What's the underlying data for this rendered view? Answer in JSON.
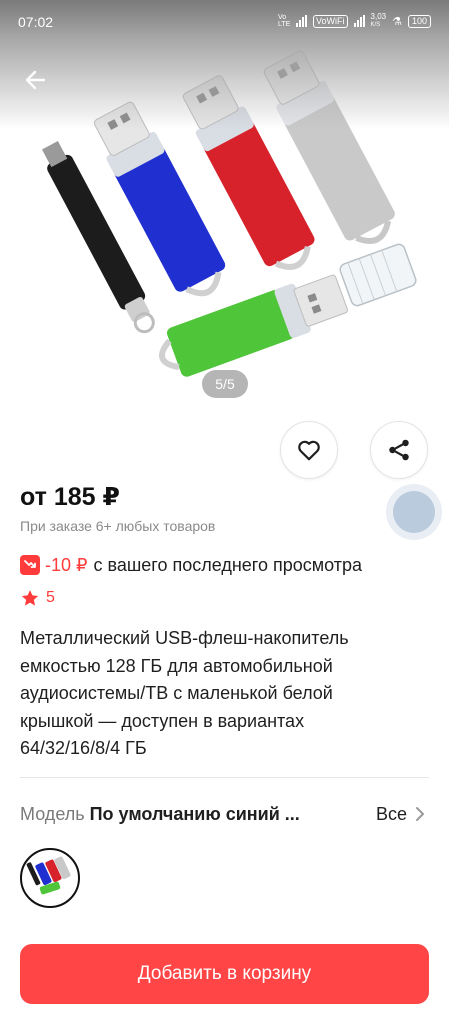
{
  "status_bar": {
    "time": "07:02",
    "volte_label": "Vo LTE",
    "vowifi_label": "VoWiFi",
    "speed_value": "3,03",
    "speed_unit": "K/S",
    "battery_label": "100"
  },
  "gallery": {
    "page_indicator": "5/5",
    "colors": {
      "black": "#1c1c1c",
      "blue": "#1f2fd0",
      "red": "#d7222b",
      "silver": "#c9c9c9",
      "green": "#4fc53a"
    }
  },
  "actions": {
    "favorite_icon": "heart-icon",
    "share_icon": "share-icon"
  },
  "product": {
    "price": "от 185 ₽",
    "price_note": "При заказе 6+ любых товаров",
    "discount_value": "-10 ₽",
    "discount_text": "с вашего последнего просмотра",
    "rating": "5",
    "title_lines": [
      "Металлический USB-флеш-накопитель",
      "емкостью 128 ГБ для автомобильной",
      "аудиосистемы/ТВ с маленькой белой",
      "крышкой — доступен в вариантах",
      "64/32/16/8/4 ГБ"
    ]
  },
  "variant": {
    "label": "Модель",
    "value": "По умолчанию синий ...",
    "all_label": "Все"
  },
  "cart": {
    "button_label": "Добавить в корзину"
  },
  "theme": {
    "accent": "#ff4545",
    "rating_color": "#ff3b3b",
    "muted": "#8a8a8a"
  }
}
